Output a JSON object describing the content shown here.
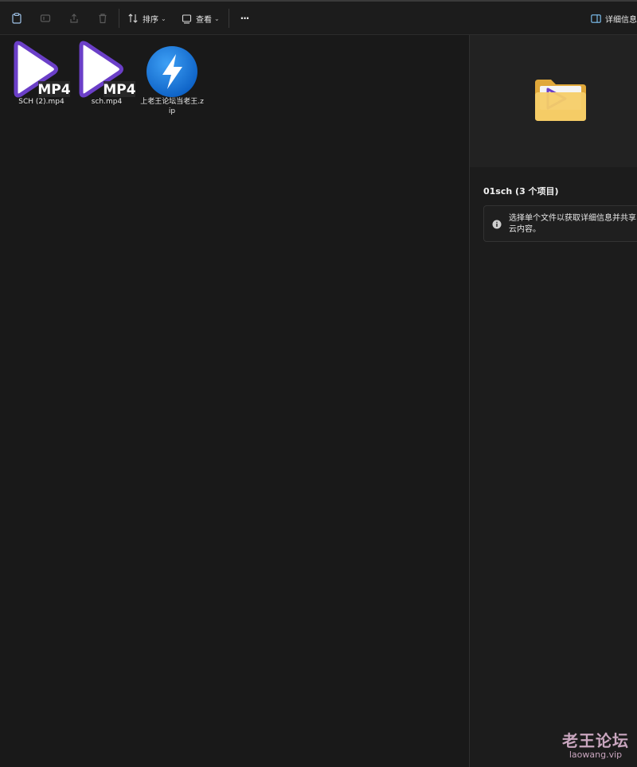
{
  "toolbar": {
    "sort_label": "排序",
    "view_label": "查看",
    "more_label": "···",
    "details_label": "详细信息"
  },
  "files": [
    {
      "name": "SCH (2).mp4",
      "icon": "mp4-file-icon",
      "badge": "MP4"
    },
    {
      "name": "sch.mp4",
      "icon": "mp4-file-icon",
      "badge": "MP4"
    },
    {
      "name": "上老王论坛当老王.zip",
      "icon": "bandizip-archive-icon"
    }
  ],
  "details": {
    "title": "01sch (3 个项目)",
    "info_text": "选择单个文件以获取详细信息并共享云内容。"
  },
  "watermark": {
    "cn": "老王论坛",
    "en": "laowang.vip"
  },
  "colors": {
    "background": "#191919",
    "panel": "#1c1c1c",
    "preview": "#222222",
    "mp4_purple": "#6b3fc8",
    "zip_blue": "#1a7fe0",
    "folder_yellow": "#f2c75c",
    "watermark": "#c9a6bf"
  }
}
